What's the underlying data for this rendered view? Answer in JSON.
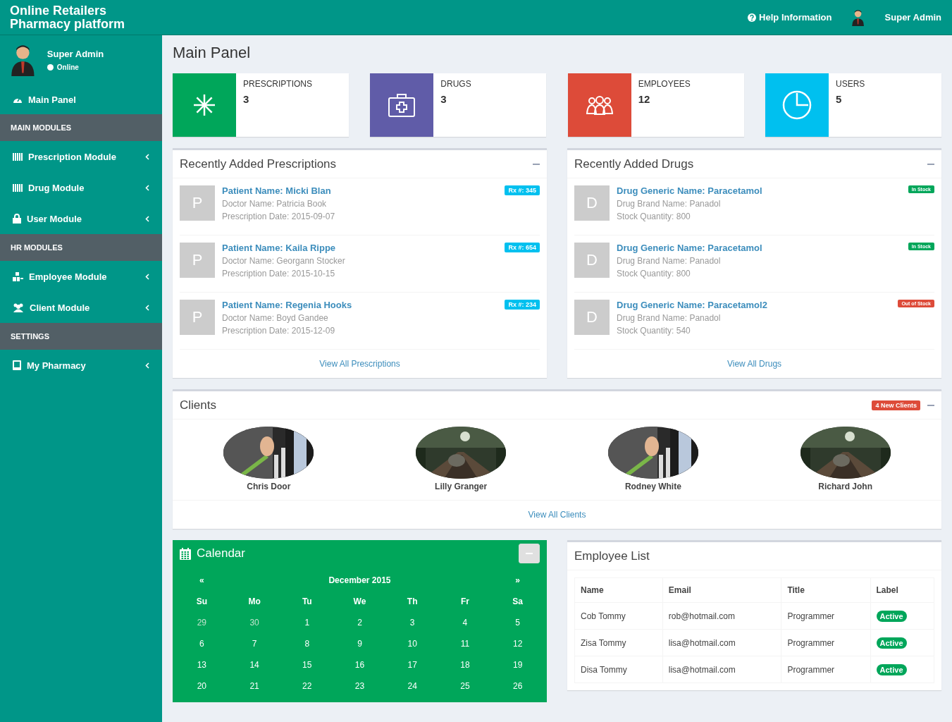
{
  "header": {
    "title_lines": [
      "Online Retailers",
      "Pharmacy platform"
    ],
    "help": "Help Information",
    "user": "Super Admin"
  },
  "sidebar": {
    "user": {
      "name": "Super Admin",
      "status": "Online"
    },
    "items": [
      {
        "kind": "link",
        "label": "Main Panel"
      },
      {
        "kind": "section",
        "label": "MAIN MODULES"
      },
      {
        "kind": "module",
        "label": "Prescription Module"
      },
      {
        "kind": "module",
        "label": "Drug Module"
      },
      {
        "kind": "module",
        "label": "User Module"
      },
      {
        "kind": "section",
        "label": "HR MODULES"
      },
      {
        "kind": "module",
        "label": "Employee Module"
      },
      {
        "kind": "module",
        "label": "Client Module"
      },
      {
        "kind": "section",
        "label": "SETTINGS"
      },
      {
        "kind": "module",
        "label": "My Pharmacy"
      }
    ]
  },
  "page_title": "Main Panel",
  "stats": [
    {
      "label": "PRESCRIPTIONS",
      "value": "3",
      "color": "#00a65a"
    },
    {
      "label": "DRUGS",
      "value": "3",
      "color": "#605ca8"
    },
    {
      "label": "EMPLOYEES",
      "value": "12",
      "color": "#dd4b39"
    },
    {
      "label": "USERS",
      "value": "5",
      "color": "#00c0ef"
    }
  ],
  "prescriptions": {
    "title": "Recently Added Prescriptions",
    "footer": "View All Prescriptions",
    "items": [
      {
        "letter": "P",
        "title": "Patient Name: Micki Blan",
        "lines": [
          "Doctor Name: Patricia Book",
          "Prescription Date: 2015-09-07"
        ],
        "badge": "Rx #: 345"
      },
      {
        "letter": "P",
        "title": "Patient Name: Kaila Rippe",
        "lines": [
          "Doctor Name: Georgann Stocker",
          "Prescription Date: 2015-10-15"
        ],
        "badge": "Rx #: 654"
      },
      {
        "letter": "P",
        "title": "Patient Name: Regenia Hooks",
        "lines": [
          "Doctor Name: Boyd Gandee",
          "Prescription Date: 2015-12-09"
        ],
        "badge": "Rx #: 234"
      }
    ]
  },
  "drugs": {
    "title": "Recently Added Drugs",
    "footer": "View All Drugs",
    "items": [
      {
        "letter": "D",
        "title": "Drug Generic Name: Paracetamol",
        "lines": [
          "Drug Brand Name: Panadol",
          "Stock Quantity: 800"
        ],
        "badge": "In Stock",
        "in_stock": true
      },
      {
        "letter": "D",
        "title": "Drug Generic Name: Paracetamol",
        "lines": [
          "Drug Brand Name: Panadol",
          "Stock Quantity: 800"
        ],
        "badge": "In Stock",
        "in_stock": true
      },
      {
        "letter": "D",
        "title": "Drug Generic Name: Paracetamol2",
        "lines": [
          "Drug Brand Name: Panadol",
          "Stock Quantity: 540"
        ],
        "badge": "Out of Stock",
        "in_stock": false
      }
    ]
  },
  "clients": {
    "title": "Clients",
    "badge": "4 New Clients",
    "footer": "View All Clients",
    "people": [
      {
        "name": "Chris Door"
      },
      {
        "name": "Lilly Granger"
      },
      {
        "name": "Rodney White"
      },
      {
        "name": "Richard John"
      }
    ]
  },
  "calendar": {
    "title": "Calendar",
    "month": "December 2015",
    "prev": "«",
    "next": "»",
    "weekdays": [
      "Su",
      "Mo",
      "Tu",
      "We",
      "Th",
      "Fr",
      "Sa"
    ],
    "weeks": [
      [
        {
          "day": "29",
          "muted": true
        },
        {
          "day": "30",
          "muted": true
        },
        {
          "day": "1",
          "muted": false
        },
        {
          "day": "2",
          "muted": false
        },
        {
          "day": "3",
          "muted": false
        },
        {
          "day": "4",
          "muted": false
        },
        {
          "day": "5",
          "muted": false
        }
      ],
      [
        {
          "day": "6",
          "muted": false
        },
        {
          "day": "7",
          "muted": false
        },
        {
          "day": "8",
          "muted": false
        },
        {
          "day": "9",
          "muted": false
        },
        {
          "day": "10",
          "muted": false
        },
        {
          "day": "11",
          "muted": false
        },
        {
          "day": "12",
          "muted": false
        }
      ],
      [
        {
          "day": "13",
          "muted": false
        },
        {
          "day": "14",
          "muted": false
        },
        {
          "day": "15",
          "muted": false
        },
        {
          "day": "16",
          "muted": false
        },
        {
          "day": "17",
          "muted": false
        },
        {
          "day": "18",
          "muted": false
        },
        {
          "day": "19",
          "muted": false
        }
      ],
      [
        {
          "day": "20",
          "muted": false
        },
        {
          "day": "21",
          "muted": false
        },
        {
          "day": "22",
          "muted": false
        },
        {
          "day": "23",
          "muted": false
        },
        {
          "day": "24",
          "muted": false
        },
        {
          "day": "25",
          "muted": false
        },
        {
          "day": "26",
          "muted": false
        }
      ]
    ]
  },
  "employees": {
    "title": "Employee List",
    "columns": [
      "Name",
      "Email",
      "Title",
      "Label"
    ],
    "rows": [
      {
        "cells": [
          "Cob Tommy",
          "rob@hotmail.com",
          "Programmer"
        ],
        "label": "Active"
      },
      {
        "cells": [
          "Zisa Tommy",
          "lisa@hotmail.com",
          "Programmer"
        ],
        "label": "Active"
      },
      {
        "cells": [
          "Disa Tommy",
          "lisa@hotmail.com",
          "Programmer"
        ],
        "label": "Active"
      }
    ]
  }
}
